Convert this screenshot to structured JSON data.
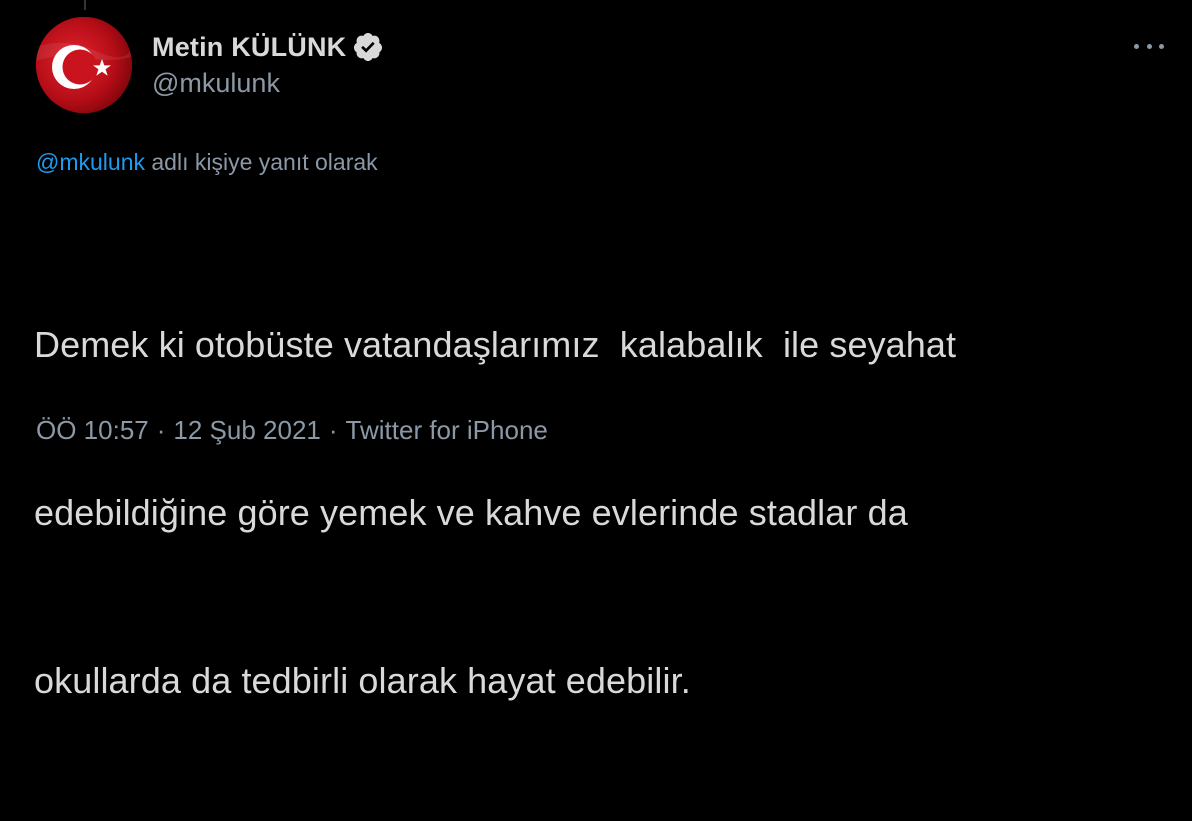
{
  "tweet": {
    "author": {
      "display_name": "Metin KÜLÜNK",
      "handle": "@mkulunk",
      "verified": true,
      "avatar_icon": "turkish-flag-avatar",
      "verified_icon": "verified-badge-icon"
    },
    "more_icon": "more-options-icon",
    "reply": {
      "mention": "@mkulunk",
      "suffix": "adlı kişiye yanıt olarak"
    },
    "text_lines": [
      "Demek ki otobüste vatandaşlarımız  kalabalık  ile seyahat",
      "edebildiğine göre yemek ve kahve evlerinde stadlar da",
      "okullarda da tedbirli olarak hayat edebilir."
    ],
    "meta": {
      "time": "ÖÖ 10:57",
      "separator": "·",
      "date": "12 Şub 2021",
      "source": "Twitter for iPhone"
    }
  },
  "colors": {
    "background": "#000000",
    "text_primary": "#d9d9d9",
    "text_secondary": "#8b98a5",
    "link": "#1d9bf0",
    "flag_red": "#c0101c"
  }
}
